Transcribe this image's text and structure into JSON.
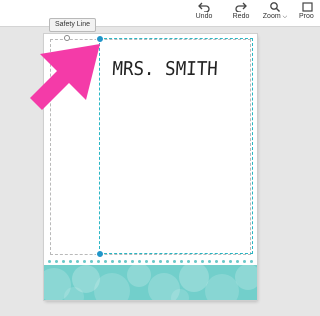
{
  "toolbar": {
    "undo_label": "Undo",
    "redo_label": "Redo",
    "zoom_label": "Zoom",
    "proof_label": "Proo"
  },
  "canvas": {
    "tooltip": "Safety Line",
    "text_content": "MRS. SMITH"
  },
  "colors": {
    "accent": "#29b6c4",
    "handle": "#2196c9",
    "arrow": "#f43ba8",
    "band": "#72cfcb"
  }
}
